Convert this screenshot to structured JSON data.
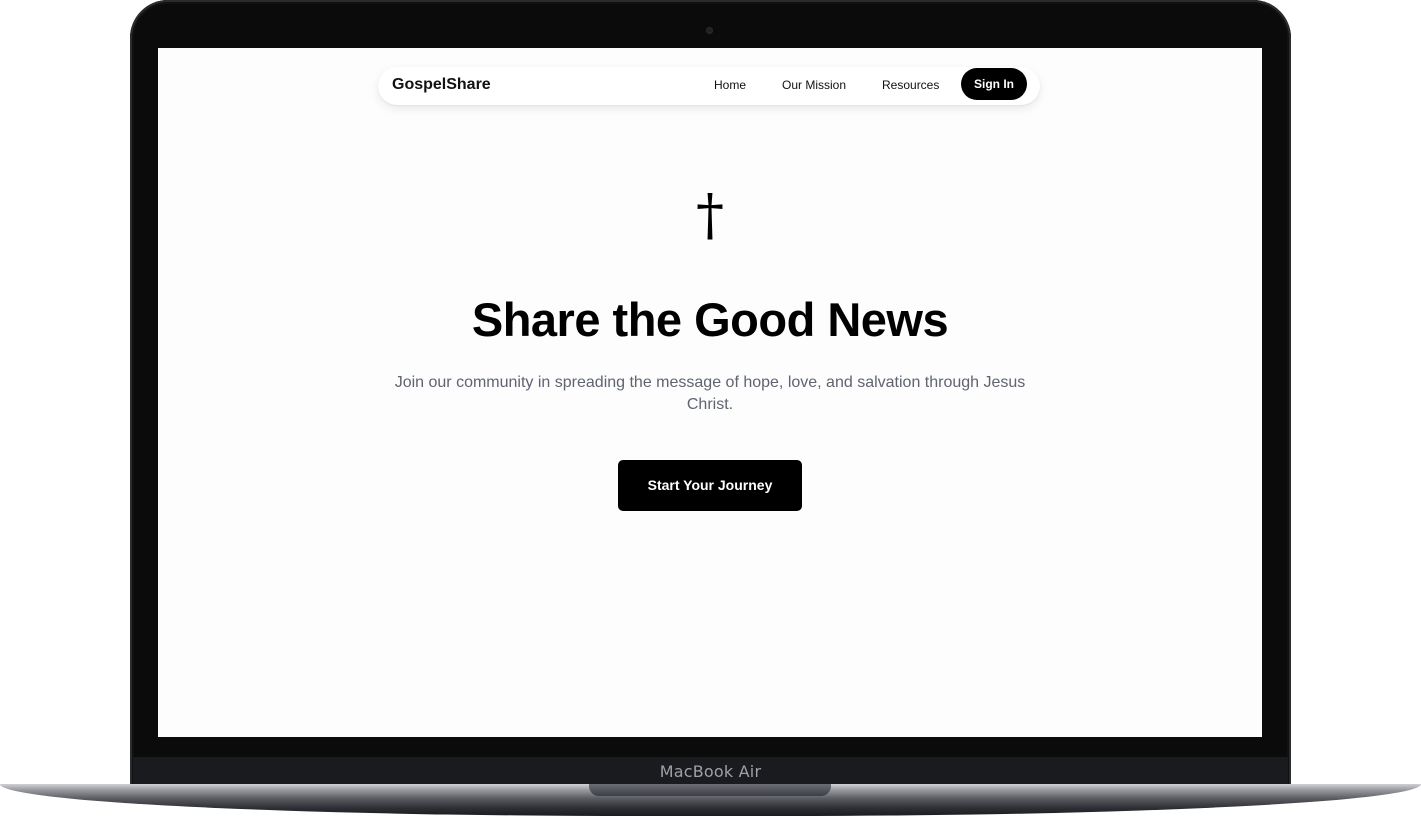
{
  "device": {
    "label": "MacBook Air"
  },
  "site": {
    "brand": "GospelShare",
    "nav": {
      "links": [
        "Home",
        "Our Mission",
        "Resources"
      ],
      "signin_label": "Sign In"
    },
    "hero": {
      "icon": "cross-icon",
      "icon_glyph": "†",
      "headline": "Share the Good News",
      "subtitle": "Join our community in spreading the message of hope, love, and salvation through Jesus Christ.",
      "cta_label": "Start Your Journey"
    }
  },
  "colors": {
    "primary": "#000000",
    "background": "#fdfdfd",
    "subtitle_text": "#5f6470"
  }
}
